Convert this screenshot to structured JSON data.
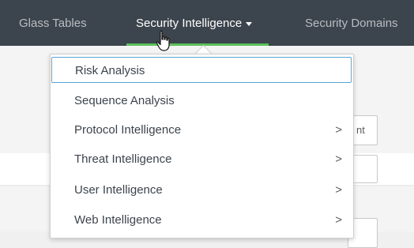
{
  "nav": {
    "items": [
      {
        "label": "Glass Tables"
      },
      {
        "label": "Security Intelligence"
      },
      {
        "label": "Security Domains"
      }
    ]
  },
  "background": {
    "button_text": "nt"
  },
  "menu": {
    "items": [
      {
        "label": "Risk Analysis",
        "has_submenu": false,
        "highlighted": true
      },
      {
        "label": "Sequence Analysis",
        "has_submenu": false
      },
      {
        "label": "Protocol Intelligence",
        "has_submenu": true
      },
      {
        "label": "Threat Intelligence",
        "has_submenu": true
      },
      {
        "label": "User Intelligence",
        "has_submenu": true
      },
      {
        "label": "Web Intelligence",
        "has_submenu": true
      }
    ],
    "submenu_glyph": ">"
  },
  "colors": {
    "nav_bg": "#3c444d",
    "active_underline": "#5cc05c",
    "highlight_border": "#5aa7d6"
  }
}
